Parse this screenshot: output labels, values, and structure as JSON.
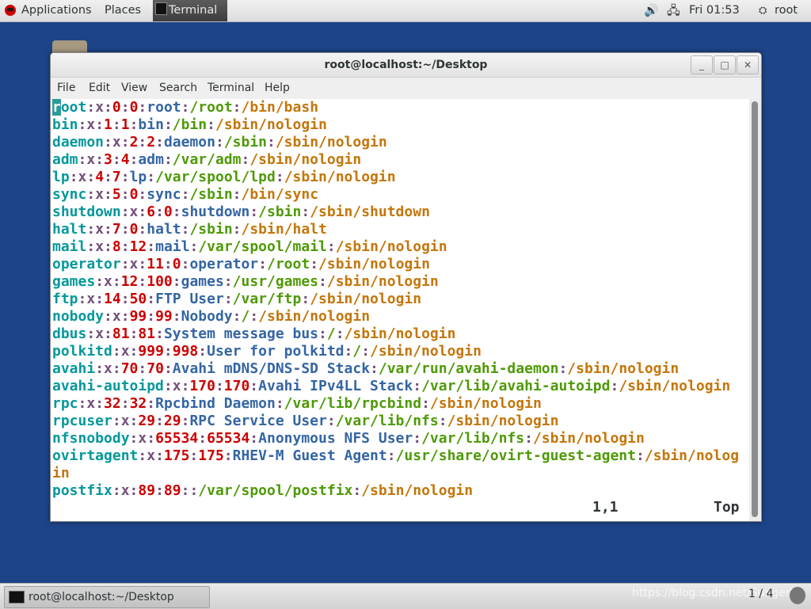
{
  "topbar": {
    "applications": "Applications",
    "places": "Places",
    "terminal": "Terminal",
    "clock": "Fri 01:53",
    "user": "root"
  },
  "window": {
    "title": "root@localhost:~/Desktop",
    "minimize": "_",
    "maximize": "□",
    "close": "✕"
  },
  "menubar": {
    "file": "File",
    "edit": "Edit",
    "view": "View",
    "search": "Search",
    "terminal": "Terminal",
    "help": "Help"
  },
  "terminal": {
    "lines": [
      {
        "user": "root",
        "x": "x",
        "uid": "0",
        "gid": "0",
        "gecos": "root",
        "home": "/root",
        "shell": "/bin/bash"
      },
      {
        "user": "bin",
        "x": "x",
        "uid": "1",
        "gid": "1",
        "gecos": "bin",
        "home": "/bin",
        "shell": "/sbin/nologin"
      },
      {
        "user": "daemon",
        "x": "x",
        "uid": "2",
        "gid": "2",
        "gecos": "daemon",
        "home": "/sbin",
        "shell": "/sbin/nologin"
      },
      {
        "user": "adm",
        "x": "x",
        "uid": "3",
        "gid": "4",
        "gecos": "adm",
        "home": "/var/adm",
        "shell": "/sbin/nologin"
      },
      {
        "user": "lp",
        "x": "x",
        "uid": "4",
        "gid": "7",
        "gecos": "lp",
        "home": "/var/spool/lpd",
        "shell": "/sbin/nologin"
      },
      {
        "user": "sync",
        "x": "x",
        "uid": "5",
        "gid": "0",
        "gecos": "sync",
        "home": "/sbin",
        "shell": "/bin/sync"
      },
      {
        "user": "shutdown",
        "x": "x",
        "uid": "6",
        "gid": "0",
        "gecos": "shutdown",
        "home": "/sbin",
        "shell": "/sbin/shutdown"
      },
      {
        "user": "halt",
        "x": "x",
        "uid": "7",
        "gid": "0",
        "gecos": "halt",
        "home": "/sbin",
        "shell": "/sbin/halt"
      },
      {
        "user": "mail",
        "x": "x",
        "uid": "8",
        "gid": "12",
        "gecos": "mail",
        "home": "/var/spool/mail",
        "shell": "/sbin/nologin"
      },
      {
        "user": "operator",
        "x": "x",
        "uid": "11",
        "gid": "0",
        "gecos": "operator",
        "home": "/root",
        "shell": "/sbin/nologin"
      },
      {
        "user": "games",
        "x": "x",
        "uid": "12",
        "gid": "100",
        "gecos": "games",
        "home": "/usr/games",
        "shell": "/sbin/nologin"
      },
      {
        "user": "ftp",
        "x": "x",
        "uid": "14",
        "gid": "50",
        "gecos": "FTP User",
        "home": "/var/ftp",
        "shell": "/sbin/nologin"
      },
      {
        "user": "nobody",
        "x": "x",
        "uid": "99",
        "gid": "99",
        "gecos": "Nobody",
        "home": "/",
        "shell": "/sbin/nologin"
      },
      {
        "user": "dbus",
        "x": "x",
        "uid": "81",
        "gid": "81",
        "gecos": "System message bus",
        "home": "/",
        "shell": "/sbin/nologin"
      },
      {
        "user": "polkitd",
        "x": "x",
        "uid": "999",
        "gid": "998",
        "gecos": "User for polkitd",
        "home": "/",
        "shell": "/sbin/nologin"
      },
      {
        "user": "avahi",
        "x": "x",
        "uid": "70",
        "gid": "70",
        "gecos": "Avahi mDNS/DNS-SD Stack",
        "home": "/var/run/avahi-daemon",
        "shell": "/sbin/nologin"
      },
      {
        "user": "avahi-autoipd",
        "x": "x",
        "uid": "170",
        "gid": "170",
        "gecos": "Avahi IPv4LL Stack",
        "home": "/var/lib/avahi-autoipd",
        "shell": "/sbin/nologin"
      },
      {
        "user": "rpc",
        "x": "x",
        "uid": "32",
        "gid": "32",
        "gecos": "Rpcbind Daemon",
        "home": "/var/lib/rpcbind",
        "shell": "/sbin/nologin"
      },
      {
        "user": "rpcuser",
        "x": "x",
        "uid": "29",
        "gid": "29",
        "gecos": "RPC Service User",
        "home": "/var/lib/nfs",
        "shell": "/sbin/nologin"
      },
      {
        "user": "nfsnobody",
        "x": "x",
        "uid": "65534",
        "gid": "65534",
        "gecos": "Anonymous NFS User",
        "home": "/var/lib/nfs",
        "shell": "/sbin/nologin"
      },
      {
        "user": "ovirtagent",
        "x": "x",
        "uid": "175",
        "gid": "175",
        "gecos": "RHEV-M Guest Agent",
        "home": "/usr/share/ovirt-guest-agent",
        "shell": "/sbin/nologin"
      },
      {
        "user": "postfix",
        "x": "x",
        "uid": "89",
        "gid": "89",
        "gecos": "",
        "home": "/var/spool/postfix",
        "shell": "/sbin/nologin"
      }
    ],
    "status_position": "1,1",
    "status_scroll": "Top"
  },
  "bottombar": {
    "task_label": "root@localhost:~/Desktop",
    "pager": "1 / 4",
    "watermark": "https://blog.csdn.net/Sungerh"
  },
  "colors": {
    "desktop": "#1d4488",
    "user": "#06989a",
    "separator": "#75507b",
    "id": "#cc0000",
    "gecos": "#3465a4",
    "home": "#4e9a06",
    "shell": "#c4760b"
  }
}
